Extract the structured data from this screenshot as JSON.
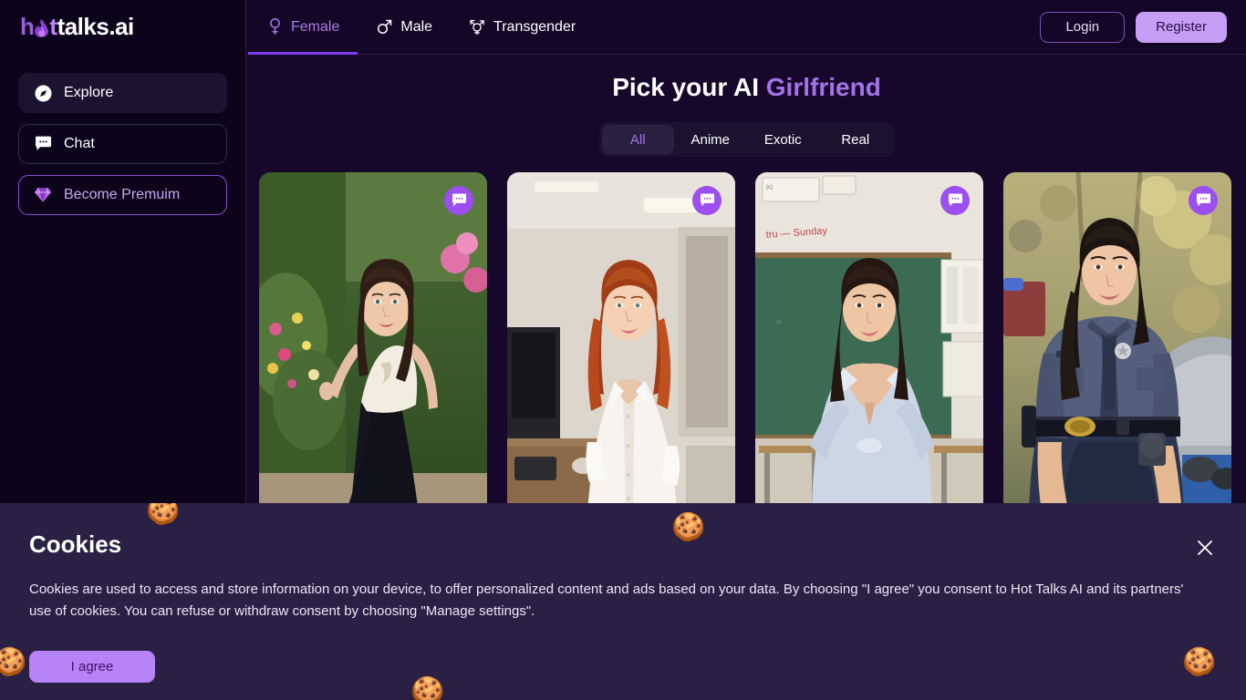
{
  "colors": {
    "bg": "#17082b",
    "sidebar_bg": "#0d041c",
    "header_bg": "#140626",
    "accent_purple": "#a472e8",
    "accent_strong": "#7c3aed",
    "register_bg": "#c79ef5",
    "cookie_bg": "#2a2044",
    "agree_bg": "#b583f5"
  },
  "header": {
    "logo": {
      "part1": "h",
      "flame_icon": "flame-icon",
      "part2": "t",
      "part3": "talks.ai"
    },
    "nav": [
      {
        "label": "Female",
        "icon": "venus-icon",
        "active": true
      },
      {
        "label": "Male",
        "icon": "mars-icon",
        "active": false
      },
      {
        "label": "Transgender",
        "icon": "transgender-icon",
        "active": false
      }
    ],
    "login_label": "Login",
    "register_label": "Register"
  },
  "sidebar": {
    "items": [
      {
        "label": "Explore",
        "icon": "compass-icon",
        "style": "filled"
      },
      {
        "label": "Chat",
        "icon": "chat-bubble-icon",
        "style": "outline"
      },
      {
        "label": "Become Premuim",
        "icon": "diamond-icon",
        "style": "premium"
      }
    ]
  },
  "main": {
    "title_plain": "Pick your AI ",
    "title_accent": "Girlfriend",
    "filters": [
      {
        "label": "All",
        "active": true
      },
      {
        "label": "Anime",
        "active": false
      },
      {
        "label": "Exotic",
        "active": false
      },
      {
        "label": "Real",
        "active": false
      }
    ],
    "cards": [
      {
        "name": "card-garden-brunette",
        "description": "Brunette woman in white camisole and black skirt standing in a flower garden",
        "chat_icon": "chat-bubble-icon"
      },
      {
        "name": "card-office-redhead",
        "description": "Red-haired woman in white button-up blouse in an office",
        "chat_icon": "chat-bubble-icon"
      },
      {
        "name": "card-classroom-teacher",
        "description": "Dark-haired woman in tied light blue shirt in a classroom with green chalkboard",
        "chat_icon": "chat-bubble-icon"
      },
      {
        "name": "card-police-officer",
        "description": "Dark-haired woman in navy police uniform beside a police car",
        "chat_icon": "chat-bubble-icon"
      }
    ]
  },
  "cookies": {
    "title": "Cookies",
    "body": "Cookies are used to access and store information on your device, to offer personalized content and ads based on your data. By choosing \"I agree\" you consent to Hot Talks AI and its partners' use of cookies. You can refuse or withdraw consent by choosing \"Manage settings\".",
    "agree_label": "I agree",
    "close_icon": "close-icon",
    "decorations": [
      "cookie-icon",
      "cookie-icon",
      "cookie-icon",
      "cookie-icon",
      "cookie-icon",
      "cookie-icon"
    ]
  }
}
